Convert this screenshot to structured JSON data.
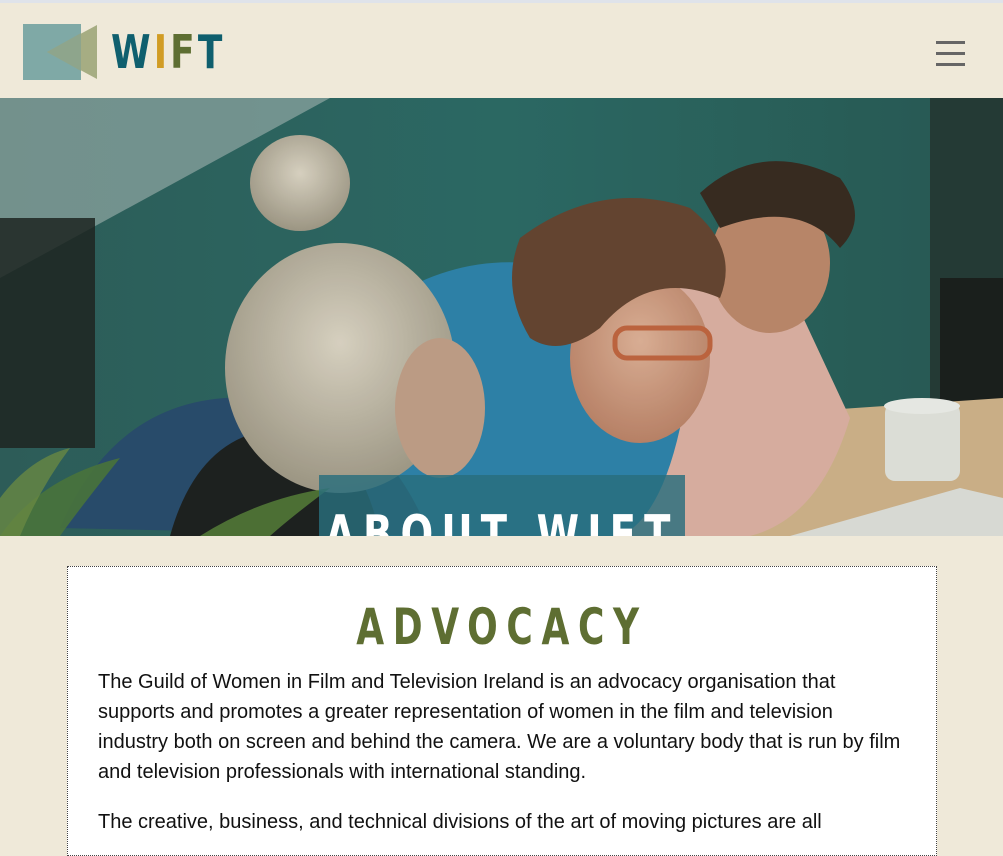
{
  "header": {
    "logo_letters": [
      "W",
      "I",
      "F",
      "T"
    ],
    "menu_icon": "hamburger-menu-icon"
  },
  "hero": {
    "image_description": "three women looking at a laptop",
    "title": "ABOUT WIFT"
  },
  "content": {
    "heading": "ADVOCACY",
    "paragraphs": [
      "The Guild of Women in Film and Television Ireland is an advocacy organisation that supports and promotes a greater representation of women in the film and television industry both on screen and behind the camera. We are a voluntary body that is run by film and television professionals with international standing.",
      "The creative, business, and technical divisions of the art of moving pictures are all"
    ]
  },
  "colors": {
    "background": "#efe9d9",
    "brand_teal": "#0f5f6e",
    "brand_gold": "#d19c24",
    "brand_olive": "#5e6e32",
    "hero_overlay": "#286e7d"
  }
}
